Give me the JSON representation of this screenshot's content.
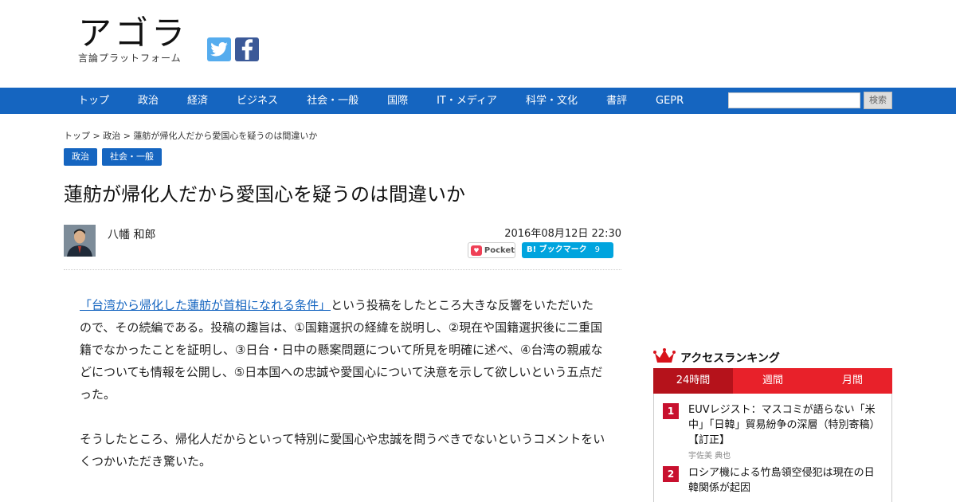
{
  "header": {
    "logo_main": "アゴラ",
    "logo_sub": "言論プラットフォーム"
  },
  "social": {
    "twitter_icon": "twitter-icon",
    "facebook_icon": "facebook-icon"
  },
  "nav": {
    "items": [
      "トップ",
      "政治",
      "経済",
      "ビジネス",
      "社会・一般",
      "国際",
      "IT・メディア",
      "科学・文化",
      "書評",
      "GEPR"
    ],
    "search_placeholder": "",
    "search_button": "検索"
  },
  "breadcrumb": "トップ > 政治 > 蓮舫が帰化人だから愛国心を疑うのは間違いか",
  "tags": [
    "政治",
    "社会・一般"
  ],
  "article": {
    "title": "蓮舫が帰化人だから愛国心を疑うのは間違いか",
    "author": "八幡 和郎",
    "date": "2016年08月12日 22:30",
    "pocket_label": "Pocket",
    "hatena_label": "B! ブックマーク",
    "hatena_count": "9",
    "link_text": "「台湾から帰化した蓮舫が首相になれる条件」",
    "para1_rest": "という投稿をしたところ大きな反響をいただいたので、その続編である。投稿の趣旨は、①国籍選択の経緯を説明し、②現在や国籍選択後に二重国籍でなかったことを証明し、③日台・日中の懸案問題について所見を明確に述べ、④台湾の親戚などについても情報を公開し、⑤日本国への忠誠や愛国心について決意を示して欲しいという五点だった。",
    "para2": "そうしたところ、帰化人だからといって特別に愛国心や忠誠を問うべきでないというコメントをいくつかいただき驚いた。"
  },
  "ranking": {
    "title": "アクセスランキング",
    "tabs": [
      "24時間",
      "週間",
      "月間"
    ],
    "items": [
      {
        "rank": "1",
        "title": "EUVレジスト：マスコミが語らない「米中」「日韓」貿易紛争の深層（特別寄稿）【訂正】",
        "author": "宇佐美 典也"
      },
      {
        "rank": "2",
        "title": "ロシア機による竹島領空侵犯は現在の日韓関係が起因",
        "author": ""
      }
    ]
  },
  "colors": {
    "nav_blue": "#1565c0",
    "ranking_red": "#e8212a",
    "ranking_dark_red": "#b5121b"
  }
}
